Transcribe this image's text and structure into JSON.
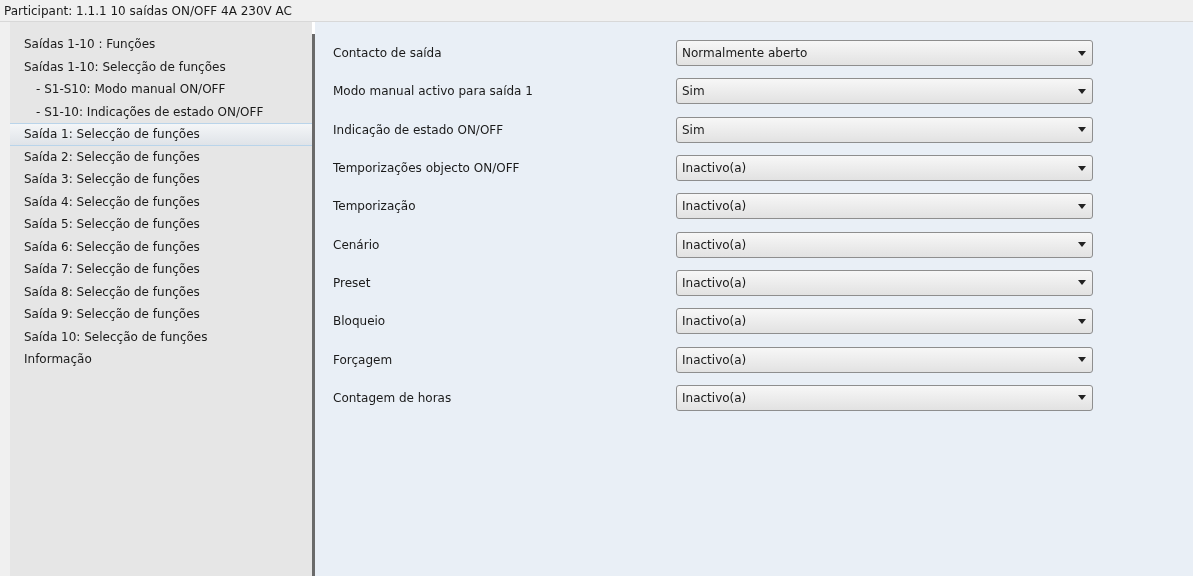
{
  "header": {
    "title": "Participant: 1.1.1  10 saídas ON/OFF 4A 230V AC"
  },
  "sidebar": {
    "items": [
      {
        "label": "Saídas 1-10 : Funções",
        "selected": false
      },
      {
        "label": "Saídas 1-10: Selecção de funções",
        "selected": false,
        "children": [
          {
            "label": "- S1-S10: Modo manual ON/OFF",
            "selected": false
          },
          {
            "label": "- S1-10: Indicações de estado ON/OFF",
            "selected": false
          }
        ]
      },
      {
        "label": "Saída 1: Selecção de funções",
        "selected": true
      },
      {
        "label": "Saída 2: Selecção de funções",
        "selected": false
      },
      {
        "label": "Saída 3: Selecção de funções",
        "selected": false
      },
      {
        "label": "Saída 4: Selecção de funções",
        "selected": false
      },
      {
        "label": "Saída 5: Selecção de funções",
        "selected": false
      },
      {
        "label": "Saída 6: Selecção de funções",
        "selected": false
      },
      {
        "label": "Saída 7: Selecção de funções",
        "selected": false
      },
      {
        "label": "Saída 8: Selecção de funções",
        "selected": false
      },
      {
        "label": "Saída 9: Selecção de funções",
        "selected": false
      },
      {
        "label": "Saída 10: Selecção de funções",
        "selected": false
      },
      {
        "label": "Informação",
        "selected": false
      }
    ]
  },
  "parameters": [
    {
      "label": "Contacto de saída",
      "value": "Normalmente aberto"
    },
    {
      "label": "Modo manual activo para saída 1",
      "value": "Sim"
    },
    {
      "label": "Indicação de estado ON/OFF",
      "value": "Sim"
    },
    {
      "label": "Temporizações objecto ON/OFF",
      "value": "Inactivo(a)"
    },
    {
      "label": "Temporização",
      "value": "Inactivo(a)"
    },
    {
      "label": "Cenário",
      "value": "Inactivo(a)"
    },
    {
      "label": "Preset",
      "value": "Inactivo(a)"
    },
    {
      "label": "Bloqueio",
      "value": "Inactivo(a)"
    },
    {
      "label": "Forçagem",
      "value": "Inactivo(a)"
    },
    {
      "label": "Contagem de horas",
      "value": "Inactivo(a)"
    }
  ]
}
